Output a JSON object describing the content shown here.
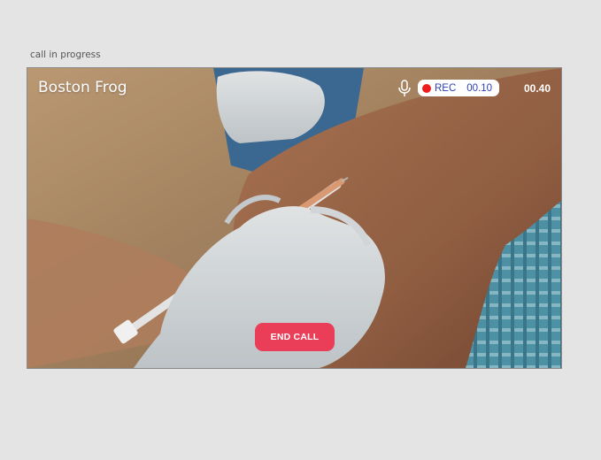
{
  "status": {
    "label": "call in progress"
  },
  "call": {
    "caller_name": "Boston Frog",
    "microphone_icon": "microphone-icon",
    "recording": {
      "indicator_color": "#ee1c1c",
      "label": "REC",
      "time": "00.10"
    },
    "elapsed_time": "00.40",
    "end_call_label": "END CALL",
    "end_call_color": "#e93d58"
  }
}
